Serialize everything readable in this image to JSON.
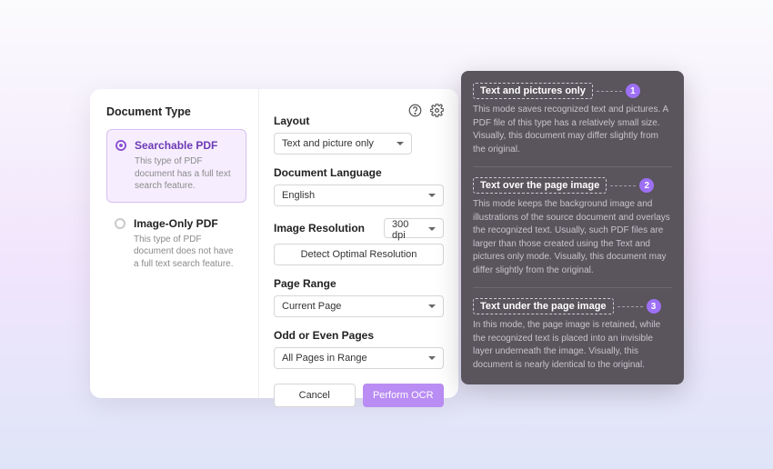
{
  "left": {
    "title": "Document Type",
    "options": [
      {
        "label": "Searchable PDF",
        "desc": "This type of PDF document has a full text search feature."
      },
      {
        "label": "Image-Only PDF",
        "desc": "This type of PDF document does not have a full text search feature."
      }
    ]
  },
  "right": {
    "layout_label": "Layout",
    "layout_value": "Text and picture only",
    "doclang_label": "Document Language",
    "doclang_value": "English",
    "imgres_label": "Image Resolution",
    "imgres_value": "300 dpi",
    "detect_btn": "Detect Optimal Resolution",
    "pagerange_label": "Page Range",
    "pagerange_value": "Current Page",
    "oddeven_label": "Odd or Even Pages",
    "oddeven_value": "All Pages in Range",
    "cancel": "Cancel",
    "perform": "Perform OCR"
  },
  "tooltip": {
    "items": [
      {
        "num": "1",
        "title": "Text and pictures only",
        "body": "This mode saves recognized text and pictures. A PDF file of this type has a relatively small size. Visually, this document may differ slightly from the original."
      },
      {
        "num": "2",
        "title": "Text over the page image",
        "body": "This mode keeps the background image and illustrations of the source document and overlays the recognized text. Usually, such PDF files are larger than those created using the Text and pictures only mode. Visually, this document may differ slightly from the original."
      },
      {
        "num": "3",
        "title": "Text under the page image",
        "body": "In this mode, the page image is retained, while the recognized text is placed into an invisible layer underneath the image. Visually, this document is nearly identical to the original."
      }
    ]
  }
}
